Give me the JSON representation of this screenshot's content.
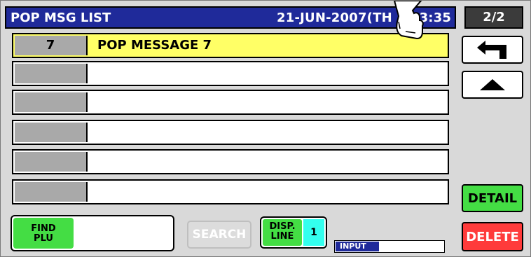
{
  "header": {
    "title": "POP MSG LIST",
    "datetime": "21-JUN-2007(TH",
    "time": "13:35",
    "page": "2/2"
  },
  "rows": [
    {
      "num": "7",
      "message": "POP MESSAGE 7",
      "selected": true
    },
    {
      "num": "",
      "message": ""
    },
    {
      "num": "",
      "message": ""
    },
    {
      "num": "",
      "message": ""
    },
    {
      "num": "",
      "message": ""
    },
    {
      "num": "",
      "message": ""
    }
  ],
  "buttons": {
    "back_icon": "return-arrow-icon",
    "up_icon": "triangle-up-icon",
    "detail": "DETAIL",
    "delete": "DELETE",
    "search": "SEARCH"
  },
  "find_plu": {
    "label_line1": "FIND",
    "label_line2": "PLU",
    "value": ""
  },
  "disp_line": {
    "label_line1": "DISP.",
    "label_line2": "LINE",
    "value": "1"
  },
  "input": {
    "label": "INPUT",
    "value": ""
  },
  "colors": {
    "header_bg": "#1f2a9a",
    "selected_row": "#ffff66",
    "green_button": "#44dd44",
    "red_button": "#ff3b3b",
    "cyan_value": "#33ffee"
  }
}
